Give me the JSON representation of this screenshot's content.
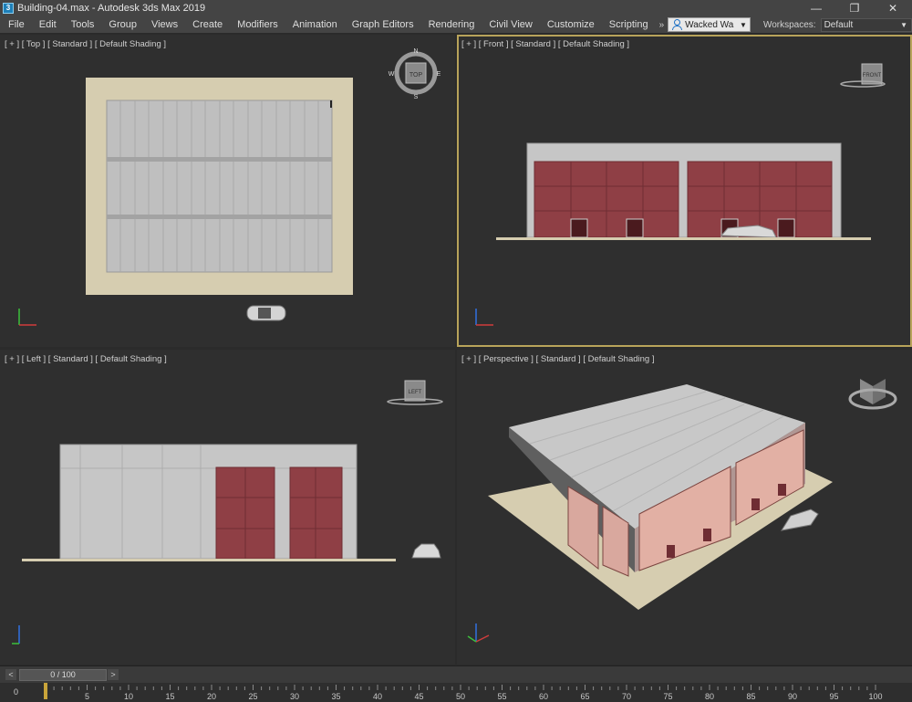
{
  "window": {
    "title": "Building-04.max - Autodesk 3ds Max 2019",
    "minimize": "—",
    "maximize": "❐",
    "close": "✕"
  },
  "menu": {
    "items": [
      "File",
      "Edit",
      "Tools",
      "Group",
      "Views",
      "Create",
      "Modifiers",
      "Animation",
      "Graph Editors",
      "Rendering",
      "Civil View",
      "Customize",
      "Scripting"
    ],
    "more": "»",
    "user": "Wacked Wa",
    "workspaces_label": "Workspaces:",
    "workspace_value": "Default"
  },
  "viewports": {
    "top": {
      "label": "[ + ] [ Top ] [ Standard ] [ Default Shading ]",
      "cube_label": "TOP",
      "compass": [
        "N",
        "E",
        "S",
        "W"
      ]
    },
    "front": {
      "label": "[ + ] [ Front ] [ Standard ] [ Default Shading ]",
      "cube_label": "FRONT"
    },
    "left": {
      "label": "[ + ] [ Left ] [ Standard ] [ Default Shading ]",
      "cube_label": "LEFT"
    },
    "perspective": {
      "label": "[ + ] [ Perspective ] [ Standard ] [ Default Shading ]"
    }
  },
  "timeline": {
    "frame": "0 / 100",
    "prev": "<",
    "next": ">",
    "ruler_start": "0",
    "ticks": [
      "5",
      "10",
      "15",
      "20",
      "25",
      "30",
      "35",
      "40",
      "45",
      "50",
      "55",
      "60",
      "65",
      "70",
      "75",
      "80",
      "85",
      "90",
      "95",
      "100"
    ]
  },
  "colors": {
    "accent_active_viewport": "#b8a35a",
    "window_red": "#8f3f45",
    "slab": "#d6cdb0"
  }
}
